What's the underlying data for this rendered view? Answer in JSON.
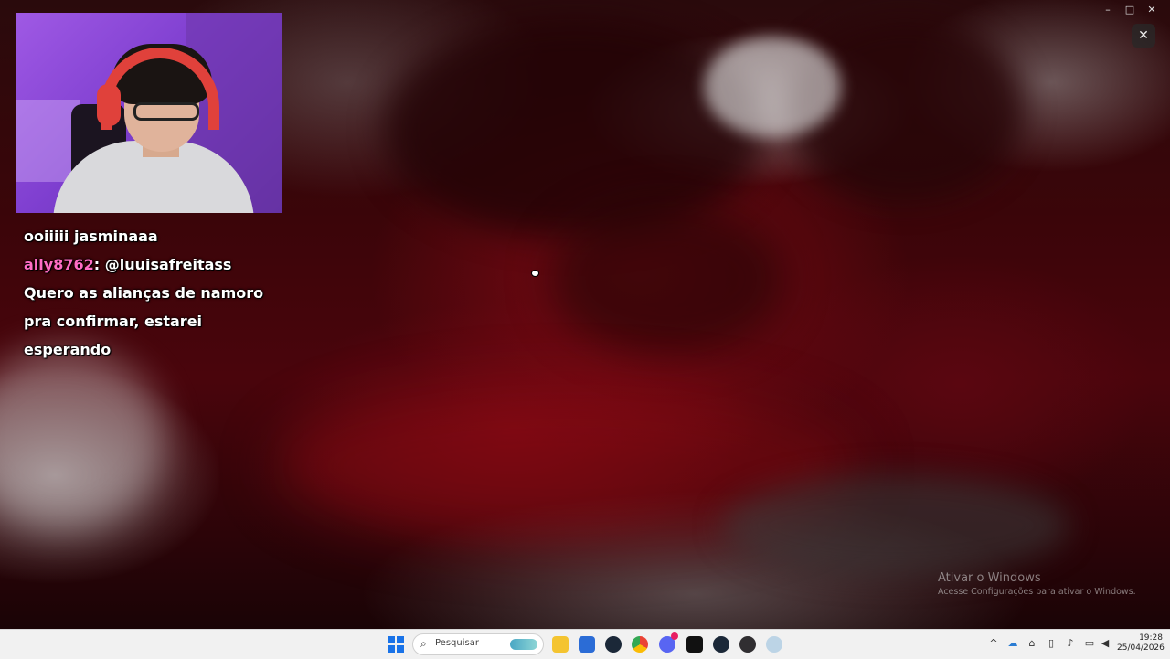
{
  "chat": {
    "line1": "ooiiiii jasminaaa",
    "username": "ally8762",
    "mention": ": @luuisafreitass",
    "line3": "Quero as alianças de namoro",
    "line4": "pra confirmar, estarei",
    "line5": "esperando"
  },
  "window_controls": {
    "minimize": "–",
    "maximize": "□",
    "close": "✕",
    "overlay_close": "✕"
  },
  "watermark": {
    "title": "Ativar o Windows",
    "subtitle": "Acesse Configurações para ativar o Windows."
  },
  "taskbar": {
    "search_placeholder": "Pesquisar",
    "time": "19:28",
    "date": "25/04/2026",
    "apps": [
      "file-explorer-icon",
      "store-icon",
      "steam-icon",
      "chrome-icon",
      "discord-icon",
      "terminal-icon",
      "steam-icon",
      "obs-icon",
      "edge-icon"
    ],
    "tray": [
      "chevron-up-icon",
      "onedrive-icon",
      "network-icon",
      "usb-icon",
      "mic-icon",
      "monitor-icon",
      "volume-icon"
    ]
  },
  "colors": {
    "username": "#ff6cc4",
    "accent": "#1a73e8",
    "background": "#3b0509"
  }
}
